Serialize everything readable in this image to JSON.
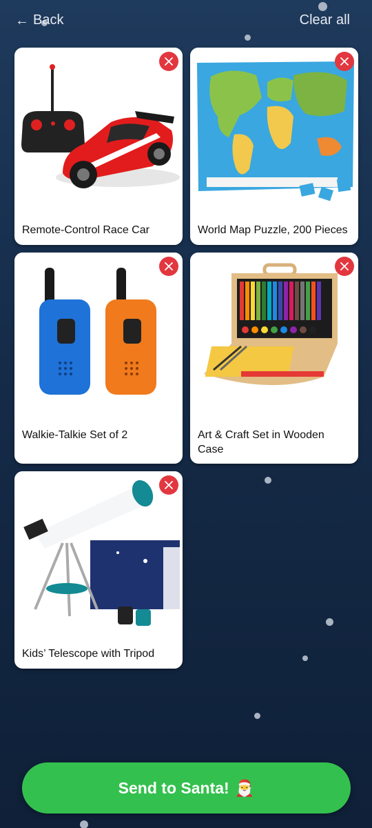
{
  "header": {
    "back_label": "Back",
    "clear_label": "Clear all"
  },
  "items": [
    {
      "name": "Remote-Control Race Car",
      "icon": "rc-car-icon"
    },
    {
      "name": "World Map Puzzle, 200 Pieces",
      "icon": "puzzle-icon"
    },
    {
      "name": "Walkie-Talkie Set of 2",
      "icon": "walkie-talkie-icon"
    },
    {
      "name": "Art & Craft Set in Wooden Case",
      "icon": "art-set-icon"
    },
    {
      "name": "Kids’ Telescope with Tripod",
      "icon": "telescope-icon"
    }
  ],
  "footer": {
    "send_label": "Send to Santa!",
    "send_emoji": "🎅"
  },
  "colors": {
    "background": "#152b48",
    "send_button": "#34c04e",
    "remove_button": "#e2373f"
  }
}
